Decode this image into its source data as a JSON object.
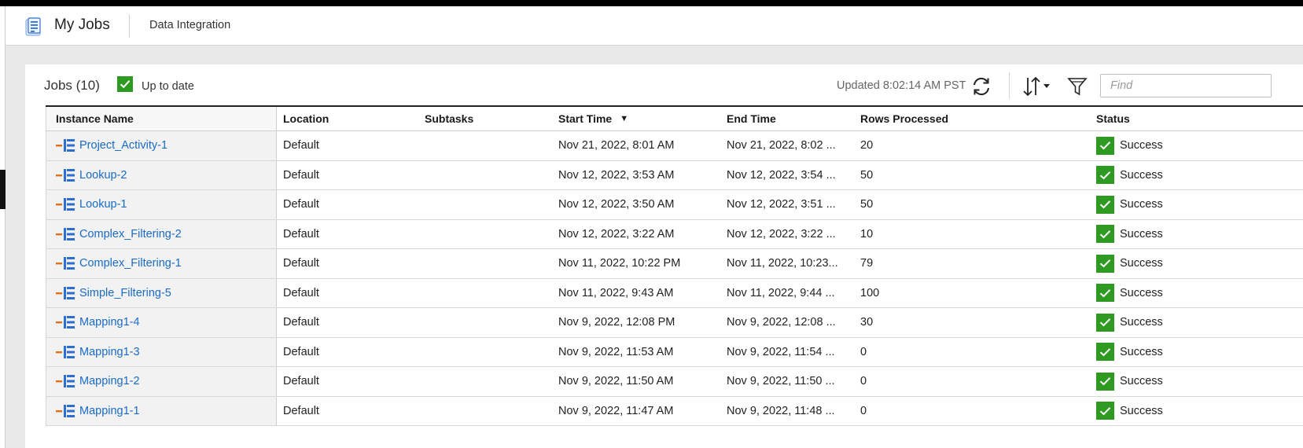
{
  "header": {
    "app_title": "My Jobs",
    "context": "Data Integration",
    "app_icon": "jobs-list-icon"
  },
  "toolbar": {
    "jobs_count_label": "Jobs (10)",
    "up_to_date_label": "Up to date",
    "updated_label": "Updated 8:02:14 AM PST",
    "find_placeholder": "Find",
    "icons": [
      "refresh-icon",
      "sort-icon",
      "filter-icon"
    ]
  },
  "table": {
    "columns": {
      "instance_name": "Instance Name",
      "location": "Location",
      "subtasks": "Subtasks",
      "start_time": "Start Time",
      "end_time": "End Time",
      "rows_processed": "Rows Processed",
      "status": "Status"
    },
    "sorted_by": "Start Time",
    "sort_direction": "descending",
    "rows": [
      {
        "name": "Project_Activity-1",
        "location": "Default",
        "subtasks": "",
        "start": "Nov 21, 2022, 8:01 AM",
        "end": "Nov 21, 2022, 8:02 ...",
        "rows": "20",
        "status": "Success"
      },
      {
        "name": "Lookup-2",
        "location": "Default",
        "subtasks": "",
        "start": "Nov 12, 2022, 3:53 AM",
        "end": "Nov 12, 2022, 3:54 ...",
        "rows": "50",
        "status": "Success"
      },
      {
        "name": "Lookup-1",
        "location": "Default",
        "subtasks": "",
        "start": "Nov 12, 2022, 3:50 AM",
        "end": "Nov 12, 2022, 3:51 ...",
        "rows": "50",
        "status": "Success"
      },
      {
        "name": "Complex_Filtering-2",
        "location": "Default",
        "subtasks": "",
        "start": "Nov 12, 2022, 3:22 AM",
        "end": "Nov 12, 2022, 3:22 ...",
        "rows": "10",
        "status": "Success"
      },
      {
        "name": "Complex_Filtering-1",
        "location": "Default",
        "subtasks": "",
        "start": "Nov 11, 2022, 10:22 PM",
        "end": "Nov 11, 2022, 10:23...",
        "rows": "79",
        "status": "Success"
      },
      {
        "name": "Simple_Filtering-5",
        "location": "Default",
        "subtasks": "",
        "start": "Nov 11, 2022, 9:43 AM",
        "end": "Nov 11, 2022, 9:44 ...",
        "rows": "100",
        "status": "Success"
      },
      {
        "name": "Mapping1-4",
        "location": "Default",
        "subtasks": "",
        "start": "Nov 9, 2022, 12:08 PM",
        "end": "Nov 9, 2022, 12:08 ...",
        "rows": "30",
        "status": "Success"
      },
      {
        "name": "Mapping1-3",
        "location": "Default",
        "subtasks": "",
        "start": "Nov 9, 2022, 11:53 AM",
        "end": "Nov 9, 2022, 11:54 ...",
        "rows": "0",
        "status": "Success"
      },
      {
        "name": "Mapping1-2",
        "location": "Default",
        "subtasks": "",
        "start": "Nov 9, 2022, 11:50 AM",
        "end": "Nov 9, 2022, 11:50 ...",
        "rows": "0",
        "status": "Success"
      },
      {
        "name": "Mapping1-1",
        "location": "Default",
        "subtasks": "",
        "start": "Nov 9, 2022, 11:47 AM",
        "end": "Nov 9, 2022, 11:48 ...",
        "rows": "0",
        "status": "Success"
      }
    ]
  },
  "colors": {
    "link": "#1a6bc4",
    "success": "#2f9a22",
    "job_icon_blue": "#2d6fd0",
    "job_icon_orange": "#e0701e"
  }
}
